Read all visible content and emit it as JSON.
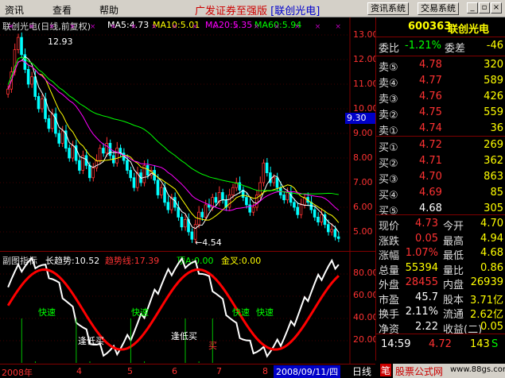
{
  "menu": {
    "items": [
      "资讯",
      "查看",
      "帮助"
    ],
    "title_prefix": "广发证券至强版",
    "title_stock": "[联创光电]",
    "btn_info": "资讯系统",
    "btn_trade": "交易系统"
  },
  "chart": {
    "header": "联创光电(日线,前复权)",
    "ma5": "MA5:4.73",
    "ma10": "MA10:5.01",
    "ma20": "MA20:5.35",
    "ma60": "MA60:5.94",
    "high_label": "12.93",
    "low_label": "←4.54",
    "y_ticks": [
      "13.00",
      "12.00",
      "11.00",
      "10.00",
      "9.00",
      "8.00",
      "7.00",
      "6.00",
      "5.00"
    ],
    "price_tag": "9.30",
    "colors": {
      "up": "#ff3232",
      "down": "#00ffff",
      "ma5": "#ffffff",
      "ma10": "#ffff00",
      "ma20": "#ff00ff",
      "ma60": "#00ff00"
    }
  },
  "sub": {
    "name": "副图指标",
    "long": "长趋势:10.52",
    "trend": "趋势线:17.39",
    "top": "顶A:0.00",
    "gold": "金叉:0.00",
    "y_ticks": [
      "80.00",
      "60.00",
      "40.00",
      "20.00"
    ],
    "labels": [
      "快速",
      "快速",
      "快速",
      "快速",
      "快速"
    ],
    "low_labels": [
      "逢低买",
      "逢低买"
    ],
    "buy": "买"
  },
  "xaxis": {
    "labels": [
      "2008年",
      "4",
      "5",
      "6",
      "7",
      "8"
    ],
    "date": "2008/09/11/四"
  },
  "panel": {
    "code": "600363",
    "name": "联创光电",
    "weibi_label": "委比",
    "weibi_val": "-1.21%",
    "weicha_label": "委差",
    "weicha_val": "-46",
    "sells": [
      {
        "l": "卖⑤",
        "p": "4.78",
        "v": "320"
      },
      {
        "l": "卖④",
        "p": "4.77",
        "v": "589"
      },
      {
        "l": "卖③",
        "p": "4.76",
        "v": "426"
      },
      {
        "l": "卖②",
        "p": "4.75",
        "v": "559"
      },
      {
        "l": "卖①",
        "p": "4.74",
        "v": "36"
      }
    ],
    "buys": [
      {
        "l": "买①",
        "p": "4.72",
        "v": "269"
      },
      {
        "l": "买②",
        "p": "4.71",
        "v": "362"
      },
      {
        "l": "买③",
        "p": "4.70",
        "v": "863"
      },
      {
        "l": "买④",
        "p": "4.69",
        "v": "85"
      },
      {
        "l": "买⑤",
        "p": "4.68",
        "v": "305"
      }
    ],
    "stats": [
      {
        "l1": "现价",
        "v1": "4.73",
        "l2": "今开",
        "v2": "4.70"
      },
      {
        "l1": "涨跌",
        "v1": "0.05",
        "l2": "最高",
        "v2": "4.94"
      },
      {
        "l1": "涨幅",
        "v1": "1.07%",
        "l2": "最低",
        "v2": "4.68"
      },
      {
        "l1": "总量",
        "v1": "55394",
        "l2": "量比",
        "v2": "0.86"
      },
      {
        "l1": "外盘",
        "v1": "28455",
        "l2": "内盘",
        "v2": "26939"
      },
      {
        "l1": "市盈",
        "v1": "45.7",
        "l2": "股本",
        "v2": "3.71亿"
      },
      {
        "l1": "换手",
        "v1": "2.11%",
        "l2": "流通",
        "v2": "2.62亿"
      },
      {
        "l1": "净资",
        "v1": "2.22",
        "l2": "收益(二)",
        "v2": "0.05"
      }
    ],
    "tick": {
      "time": "14:59",
      "price": "4.72",
      "vol": "143",
      "side": "S"
    }
  },
  "bottom": {
    "tab1": "日线",
    "tab2": "笔",
    "brand": "股票公式网",
    "url": "www.88gs.com"
  }
}
